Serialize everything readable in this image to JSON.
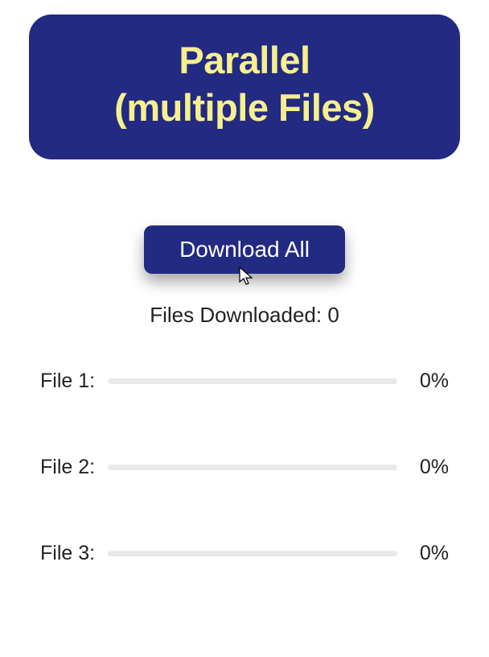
{
  "header": {
    "title_line1": "Parallel",
    "title_line2": "(multiple Files)"
  },
  "button": {
    "download_all_label": "Download All"
  },
  "status": {
    "label_prefix": "Files Downloaded: ",
    "count": "0"
  },
  "files": [
    {
      "label": "File 1:",
      "percent": "0%",
      "progress_width": "0%"
    },
    {
      "label": "File 2:",
      "percent": "0%",
      "progress_width": "0%"
    },
    {
      "label": "File 3:",
      "percent": "0%",
      "progress_width": "0%"
    }
  ]
}
